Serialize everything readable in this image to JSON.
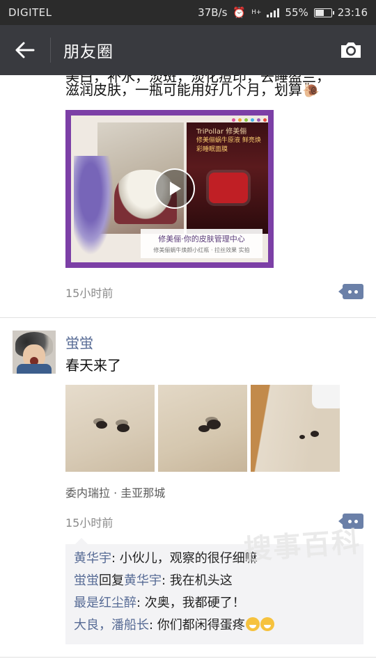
{
  "status_bar": {
    "carrier": "DIGITEL",
    "speed": "37B/s",
    "network": "H+",
    "battery": "55%",
    "battery_level": 0.55,
    "clock": "23:16"
  },
  "header": {
    "title": "朋友圈"
  },
  "post1": {
    "text_line1": "美白，补水，淡斑，淡化痘印，去睡盈兰，",
    "text_line2": "滋润皮肤，一瓶可能用好几个月，划算",
    "video": {
      "brand": "TriPollar 修美俪",
      "headline": "修美俪蜗牛原液 鲜亮焕彩睡眠面膜",
      "caption": "修美俪·你的皮肤管理中心",
      "caption_sub": "修美俪蜗牛焕颜小红瓶 · 拉丝效果 实拍"
    },
    "time": "15小时前"
  },
  "post2": {
    "nickname": "蛍蛍",
    "text": "春天来了",
    "location": "委内瑞拉 · 圭亚那城",
    "time": "15小时前",
    "comments": [
      {
        "name": "黄华宇",
        "text": ": 小伙儿，观察的很仔细嘛"
      },
      {
        "name": "蛍蛍",
        "reply_word": "回复",
        "reply_to": "黄华宇",
        "text": ": 我在机头这"
      },
      {
        "name": "最是红尘醉",
        "text": ": 次奥，我都硬了！"
      },
      {
        "name": "大良",
        "sep": "，",
        "name2": "潘船长",
        "text": ": 你们都闲得蛋疼"
      }
    ]
  },
  "watermark": "搜事百科",
  "colors": {
    "header_bg": "#393a3f",
    "link_blue": "#576b95",
    "video_frame": "#7c3fa6"
  }
}
